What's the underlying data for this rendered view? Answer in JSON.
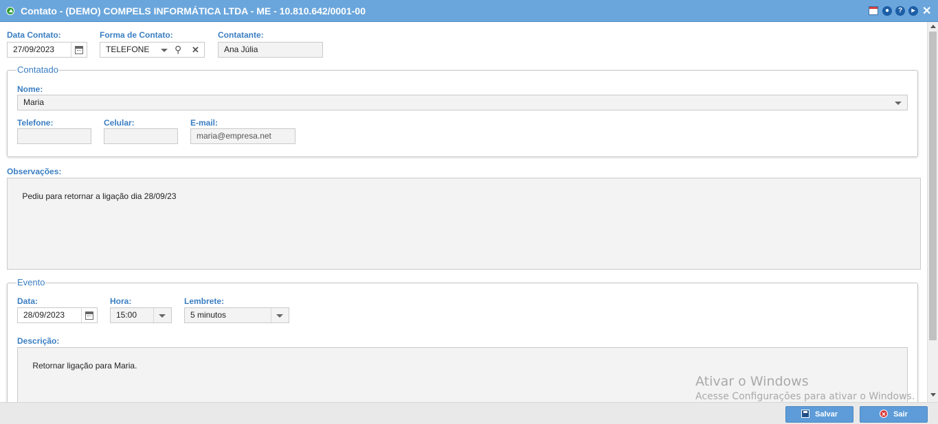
{
  "window": {
    "title": "Contato - (DEMO) COMPELS INFORMÁTICA LTDA - ME - 10.810.642/0001-00",
    "icons": [
      "calendar-icon",
      "record-icon",
      "help-icon",
      "play-icon",
      "close-icon"
    ]
  },
  "contact": {
    "date_label": "Data Contato:",
    "date_value": "27/09/2023",
    "form_label": "Forma de Contato:",
    "form_value": "TELEFONE",
    "contactor_label": "Contatante:",
    "contactor_value": "Ana Júlia"
  },
  "contacted": {
    "legend": "Contatado",
    "name_label": "Nome:",
    "name_value": "Maria",
    "phone_label": "Telefone:",
    "phone_value": "",
    "mobile_label": "Celular:",
    "mobile_value": "",
    "email_label": "E-mail:",
    "email_value": "maria@empresa.net"
  },
  "observations": {
    "label": "Observações:",
    "value": "Pediu para retornar a ligação dia 28/09/23"
  },
  "event": {
    "legend": "Evento",
    "date_label": "Data:",
    "date_value": "28/09/2023",
    "time_label": "Hora:",
    "time_value": "15:00",
    "reminder_label": "Lembrete:",
    "reminder_value": "5 minutos",
    "description_label": "Descrição:",
    "description_value": "Retornar ligação para Maria."
  },
  "watermark": {
    "line1": "Ativar o Windows",
    "line2": "Acesse Configurações para ativar o Windows."
  },
  "footer": {
    "save_label": "Salvar",
    "exit_label": "Sair"
  },
  "colors": {
    "titlebar": "#6aa6dc",
    "label": "#3a7ec2",
    "button": "#5d9cd8"
  }
}
